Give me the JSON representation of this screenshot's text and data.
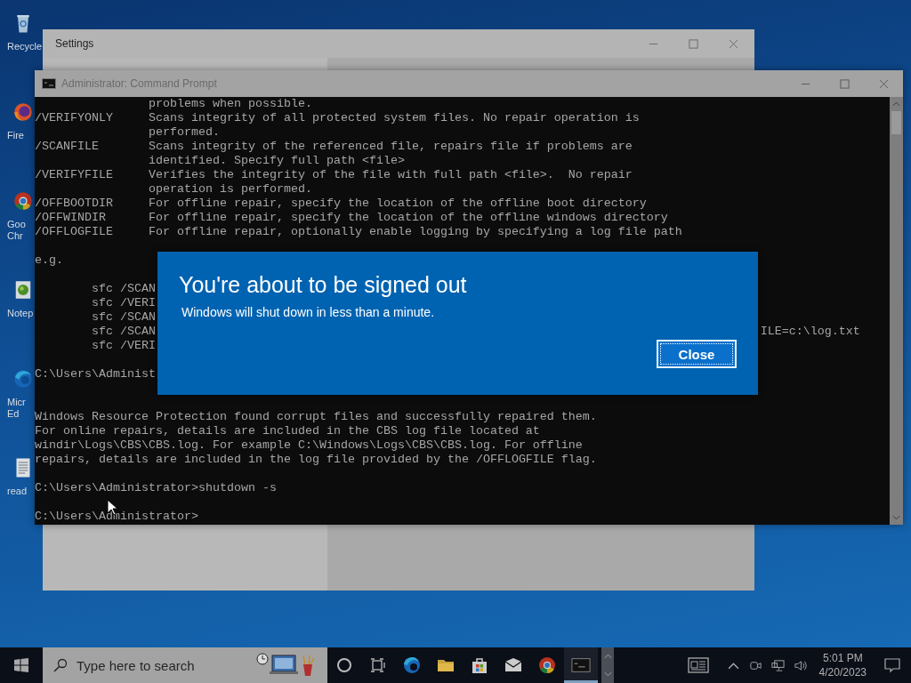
{
  "desktop_icons": [
    {
      "kind": "recycle-bin",
      "lines": [
        "Recycle"
      ]
    },
    {
      "kind": "firefox",
      "lines": [
        "Fire"
      ]
    },
    {
      "kind": "chrome",
      "lines": [
        "Goo",
        "Chr"
      ]
    },
    {
      "kind": "notepad",
      "lines": [
        "Notep"
      ]
    },
    {
      "kind": "edge",
      "lines": [
        "Micr",
        "Ed"
      ]
    },
    {
      "kind": "text-file",
      "lines": [
        "read"
      ]
    }
  ],
  "settings_window": {
    "title": "Settings"
  },
  "command_prompt": {
    "title": "Administrator: Command Prompt",
    "lines": [
      {
        "kind": "text",
        "text": "                problems when possible."
      },
      {
        "kind": "text",
        "text": "/VERIFYONLY     Scans integrity of all protected system files. No repair operation is"
      },
      {
        "kind": "text",
        "text": "                performed."
      },
      {
        "kind": "text",
        "text": "/SCANFILE       Scans integrity of the referenced file, repairs file if problems are"
      },
      {
        "kind": "text",
        "text": "                identified. Specify full path <file>"
      },
      {
        "kind": "text",
        "text": "/VERIFYFILE     Verifies the integrity of the file with full path <file>.  No repair"
      },
      {
        "kind": "text",
        "text": "                operation is performed."
      },
      {
        "kind": "text",
        "text": "/OFFBOOTDIR     For offline repair, specify the location of the offline boot directory"
      },
      {
        "kind": "text",
        "text": "/OFFWINDIR      For offline repair, specify the location of the offline windows directory"
      },
      {
        "kind": "text",
        "text": "/OFFLOGFILE     For offline repair, optionally enable logging by specifying a log file path"
      },
      {
        "kind": "blank"
      },
      {
        "kind": "text",
        "text": "e.g."
      },
      {
        "kind": "blank"
      },
      {
        "kind": "text",
        "text": "        sfc /SCAN"
      },
      {
        "kind": "text",
        "text": "        sfc /VERI"
      },
      {
        "kind": "text",
        "text": "        sfc /SCAN"
      },
      {
        "kind": "text",
        "text": "        sfc /SCAN",
        "tail": "ILE=c:\\log.txt"
      },
      {
        "kind": "text",
        "text": "        sfc /VERI"
      },
      {
        "kind": "blank"
      },
      {
        "kind": "text",
        "text": "C:\\Users\\Administ"
      },
      {
        "kind": "blank"
      },
      {
        "kind": "blank"
      },
      {
        "kind": "text",
        "text": "Windows Resource Protection found corrupt files and successfully repaired them."
      },
      {
        "kind": "text",
        "text": "For online repairs, details are included in the CBS log file located at"
      },
      {
        "kind": "text",
        "text": "windir\\Logs\\CBS\\CBS.log. For example C:\\Windows\\Logs\\CBS\\CBS.log. For offline"
      },
      {
        "kind": "text",
        "text": "repairs, details are included in the log file provided by the /OFFLOGFILE flag."
      },
      {
        "kind": "blank"
      },
      {
        "kind": "text",
        "text": "C:\\Users\\Administrator>shutdown -s"
      },
      {
        "kind": "blank"
      },
      {
        "kind": "text",
        "text": "C:\\Users\\Administrator>"
      }
    ]
  },
  "dialog": {
    "title": "You're about to be signed out",
    "message": "Windows will shut down in less than a minute.",
    "button": "Close"
  },
  "taskbar": {
    "search": {
      "placeholder": "Type here to search"
    },
    "apps": [
      {
        "kind": "cortana",
        "selected": false
      },
      {
        "kind": "task-view",
        "selected": false
      },
      {
        "kind": "edge",
        "selected": false
      },
      {
        "kind": "explorer",
        "selected": false
      },
      {
        "kind": "store",
        "selected": false
      },
      {
        "kind": "mail",
        "selected": false
      },
      {
        "kind": "chrome",
        "selected": false
      },
      {
        "kind": "terminal",
        "selected": true
      }
    ],
    "tray": [
      {
        "kind": "news"
      },
      {
        "kind": "caret"
      },
      {
        "kind": "camera"
      },
      {
        "kind": "network"
      },
      {
        "kind": "volume"
      }
    ],
    "clock": {
      "time": "5:01 PM",
      "date": "4/20/2023"
    }
  }
}
